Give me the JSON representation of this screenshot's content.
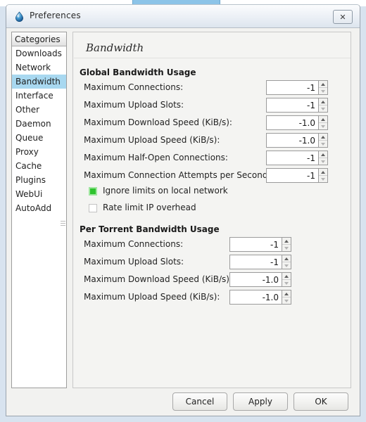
{
  "background": {
    "tab_color": "#8cc4e8",
    "body_color": "#d8e3ef"
  },
  "window": {
    "title": "Preferences",
    "icon": "deluge-drop-icon",
    "close_label": "✕"
  },
  "sidebar": {
    "header": "Categories",
    "selected": "Bandwidth",
    "items": [
      {
        "label": "Downloads"
      },
      {
        "label": "Network"
      },
      {
        "label": "Bandwidth"
      },
      {
        "label": "Interface"
      },
      {
        "label": "Other"
      },
      {
        "label": "Daemon"
      },
      {
        "label": "Queue"
      },
      {
        "label": "Proxy"
      },
      {
        "label": "Cache"
      },
      {
        "label": "Plugins"
      },
      {
        "label": "WebUi"
      },
      {
        "label": "AutoAdd"
      }
    ]
  },
  "content": {
    "title": "Bandwidth",
    "global_section": {
      "title": "Global Bandwidth Usage",
      "rows": [
        {
          "label": "Maximum Connections:",
          "value": "-1"
        },
        {
          "label": "Maximum Upload Slots:",
          "value": "-1"
        },
        {
          "label": "Maximum Download Speed (KiB/s):",
          "value": "-1.0"
        },
        {
          "label": "Maximum Upload Speed (KiB/s):",
          "value": "-1.0"
        },
        {
          "label": "Maximum Half-Open Connections:",
          "value": "-1"
        },
        {
          "label": "Maximum Connection Attempts per Second:",
          "value": "-1"
        }
      ],
      "checkboxes": [
        {
          "label": "Ignore limits on local network",
          "checked": true
        },
        {
          "label": "Rate limit IP overhead",
          "checked": false
        }
      ]
    },
    "per_torrent_section": {
      "title": "Per Torrent Bandwidth Usage",
      "rows": [
        {
          "label": "Maximum Connections:",
          "value": "-1"
        },
        {
          "label": "Maximum Upload Slots:",
          "value": "-1"
        },
        {
          "label": "Maximum Download Speed (KiB/s):",
          "value": "-1.0"
        },
        {
          "label": "Maximum Upload Speed (KiB/s):",
          "value": "-1.0"
        }
      ]
    }
  },
  "buttons": {
    "cancel": "Cancel",
    "apply": "Apply",
    "ok": "OK"
  },
  "colors": {
    "selection": "#a8d8f0",
    "checkbox_on": "#2fc32f"
  }
}
